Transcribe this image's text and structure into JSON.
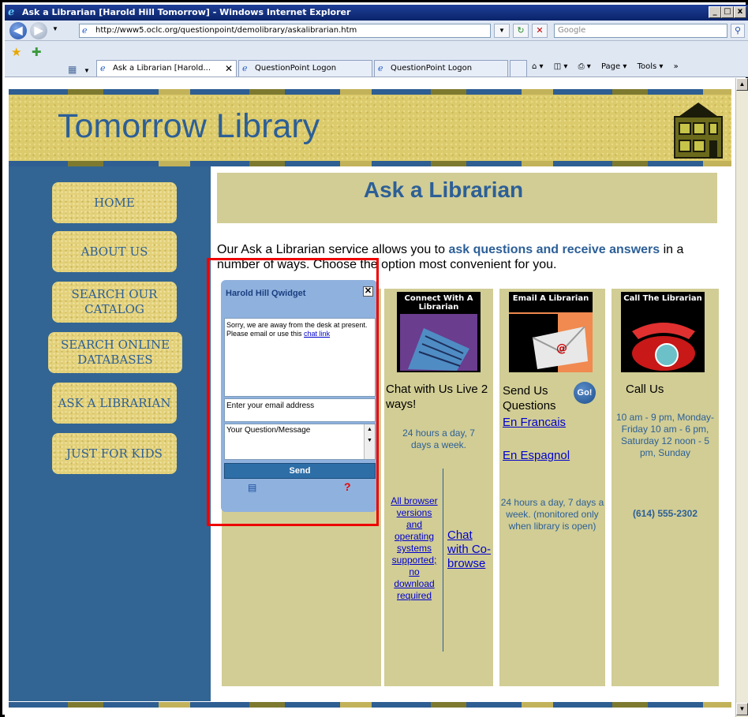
{
  "window": {
    "title": "Ask a Librarian [Harold Hill Tomorrow] - Windows Internet Explorer",
    "minimize": "_",
    "maximize": "□",
    "close": "x"
  },
  "toolbar": {
    "back": "◀",
    "forward": "▶",
    "address": "http://www5.oclc.org/questionpoint/demolibrary/askalibrarian.htm",
    "search_placeholder": "Google",
    "refresh": "↻",
    "stop": "✕",
    "search_go": "⚲"
  },
  "tabs": [
    {
      "label": "Ask a Librarian [Harold...",
      "close": "✕"
    },
    {
      "label": "QuestionPoint Logon"
    },
    {
      "label": "QuestionPoint Logon"
    }
  ],
  "commandbar": {
    "home": "⌂ ▾",
    "feeds": "◫ ▾",
    "print": "⎙ ▾",
    "page": "Page ▾",
    "tools": "Tools ▾",
    "more": "»"
  },
  "site": {
    "name": "Tomorrow Library",
    "nav": [
      "HOME",
      "ABOUT US",
      "SEARCH OUR CATALOG",
      "SEARCH ONLINE DATABASES",
      "ASK A LIBRARIAN",
      "JUST FOR KIDS"
    ]
  },
  "main": {
    "title": "Ask a Librarian",
    "intro_pre": "Our Ask a Librarian service allows you to ",
    "intro_bold": "ask questions and receive answers",
    "intro_post": " in a number of ways. Choose the option most convenient for you."
  },
  "qwidget": {
    "title": "Harold Hill Qwidget",
    "close": "✕",
    "message": "Sorry, we are away from the desk at present. Please email or use this ",
    "message_link": "chat link",
    "email_placeholder": "Enter your email address",
    "question_placeholder": "Your Question/Message",
    "send": "Send",
    "help": "?"
  },
  "chat": {
    "image_caption": "Connect With A Librarian",
    "heading": "Chat with Us Live 2 ways!",
    "hours": "24 hours a day, 7 days a week.",
    "browsers_link": "All browser versions and operating systems supported; no download required",
    "cobrowse_link": "Chat with Co-browse"
  },
  "email": {
    "image_caption": "Email A Librarian",
    "heading": "Send Us Questions",
    "go": "Go!",
    "french": "En Francais",
    "spanish": "En Espagnol",
    "hours": "24 hours a day, 7 days a week. (monitored only when library is open)"
  },
  "call": {
    "image_caption": "Call The Librarian",
    "heading": "Call Us",
    "hours": "10 am - 9 pm, Monday-Friday 10 am - 6 pm, Saturday 12 noon - 5 pm, Sunday",
    "phone": "(614) 555-2302"
  },
  "colors": {
    "accent_blue": "#2c5f97",
    "tan": "#d1cd95",
    "nav_blue": "#326593",
    "highlight_red": "#e00000"
  }
}
